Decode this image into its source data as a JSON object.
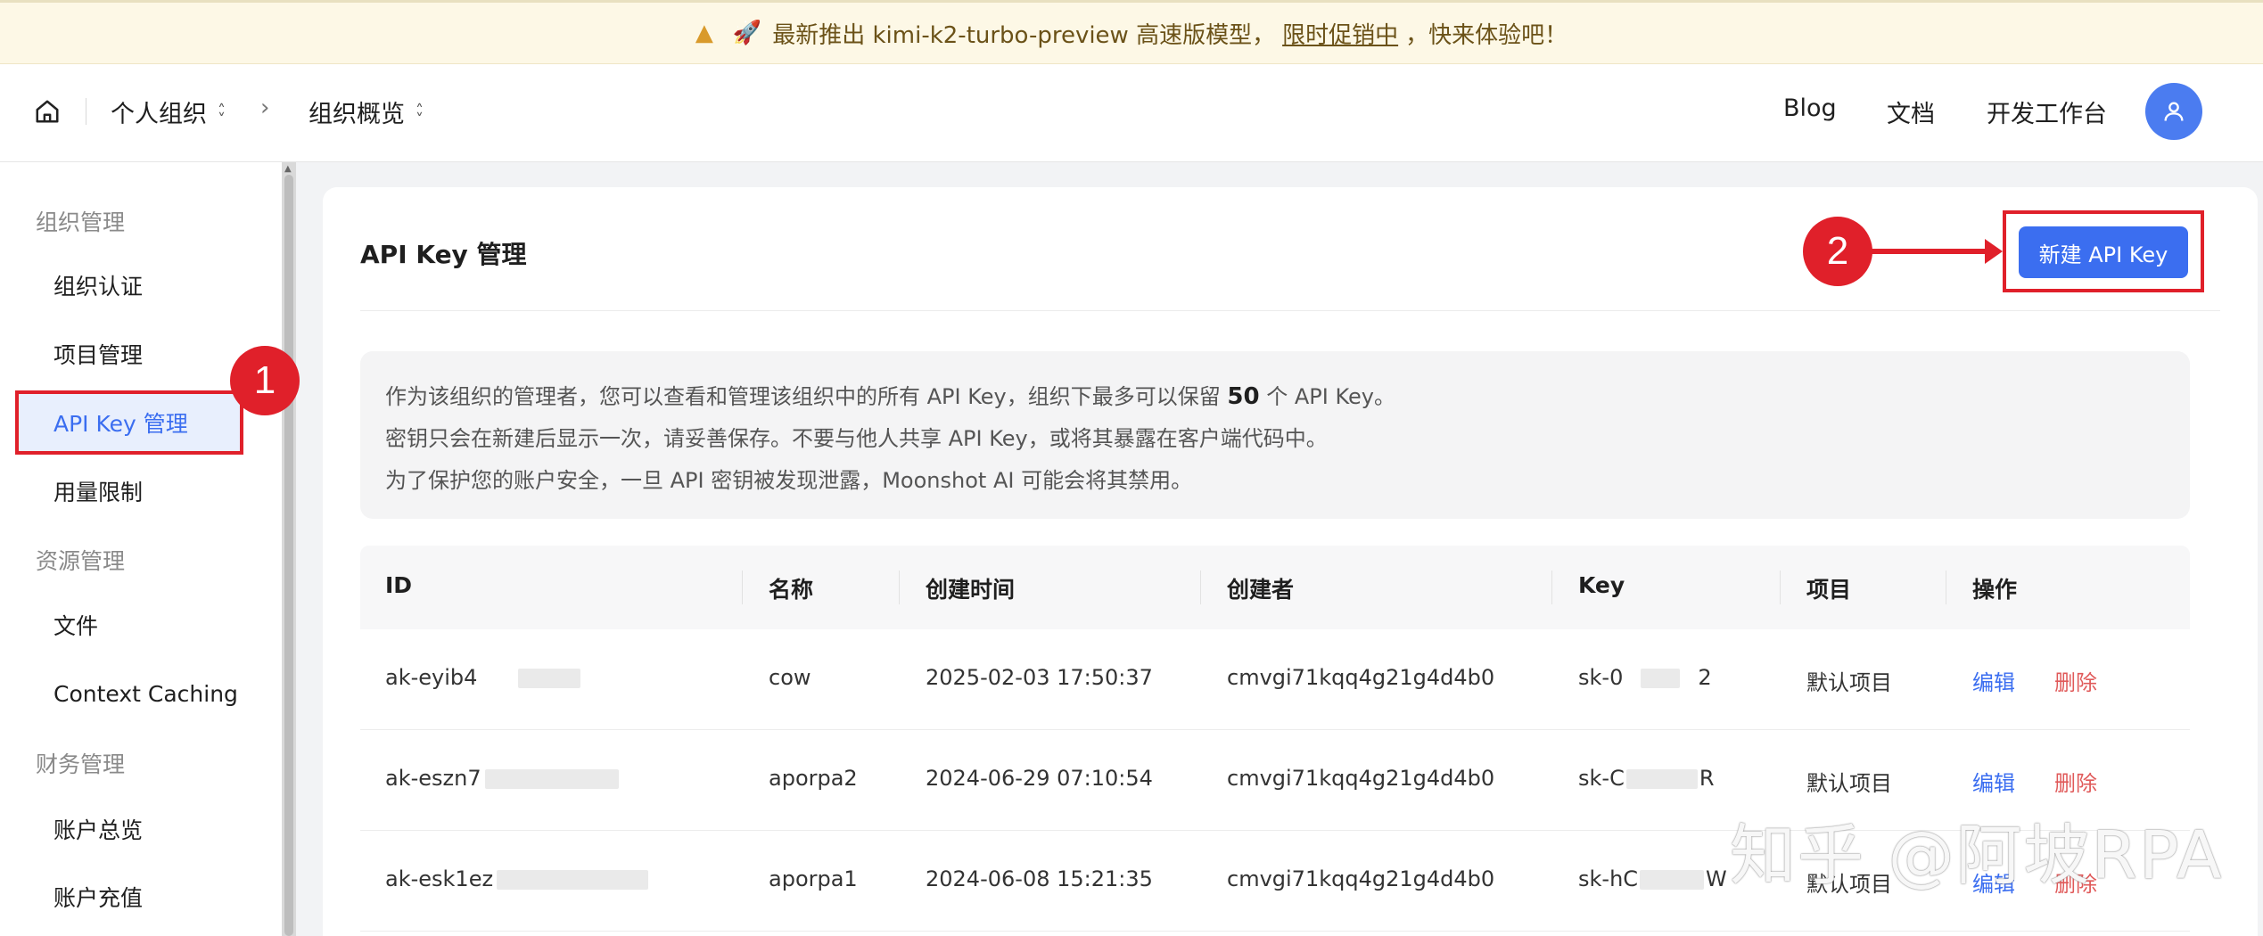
{
  "banner": {
    "text_before": "最新推出 kimi-k2-turbo-preview 高速版模型，",
    "link": "限时促销中",
    "text_after": "，快来体验吧！"
  },
  "topnav": {
    "org": "个人组织",
    "page": "组织概览",
    "links": [
      "Blog",
      "文档",
      "开发工作台"
    ]
  },
  "sidebar": {
    "groups": [
      {
        "title": "组织管理",
        "items": [
          "组织认证",
          "项目管理",
          "API Key 管理",
          "用量限制"
        ]
      },
      {
        "title": "资源管理",
        "items": [
          "文件",
          "Context Caching"
        ]
      },
      {
        "title": "财务管理",
        "items": [
          "账户总览",
          "账户充值"
        ]
      }
    ],
    "active": "API Key 管理"
  },
  "annotations": [
    "1",
    "2"
  ],
  "main": {
    "title": "API Key 管理",
    "new_button": "新建 API Key",
    "info": {
      "line1_before": "作为该组织的管理者，您可以查看和管理该组织中的所有 API Key，组织下最多可以保留",
      "line1_limit": "50",
      "line1_after": "个 API Key。",
      "line2": "密钥只会在新建后显示一次，请妥善保存。不要与他人共享 API Key，或将其暴露在客户端代码中。",
      "line3": "为了保护您的账户安全，一旦 API 密钥被发现泄露，Moonshot AI 可能会将其禁用。"
    },
    "table": {
      "headers": [
        "ID",
        "名称",
        "创建时间",
        "创建者",
        "Key",
        "项目",
        "操作"
      ],
      "rows": [
        {
          "id": "ak-eyib4",
          "name": "cow",
          "created": "2025-02-03 17:50:37",
          "creator": "cmvgi71kqq4g21g4d4b0",
          "key_a": "sk-0",
          "key_b": "2",
          "project": "默认项目",
          "edit": "编辑",
          "delete": "删除"
        },
        {
          "id": "ak-eszn7",
          "name": "aporpa2",
          "created": "2024-06-29 07:10:54",
          "creator": "cmvgi71kqq4g21g4d4b0",
          "key_a": "sk-C",
          "key_b": "R",
          "project": "默认项目",
          "edit": "编辑",
          "delete": "删除"
        },
        {
          "id": "ak-esk1ez",
          "name": "aporpa1",
          "created": "2024-06-08 15:21:35",
          "creator": "cmvgi71kqq4g21g4d4b0",
          "key_a": "sk-hC",
          "key_b": "W",
          "project": "默认项目",
          "edit": "编辑",
          "delete": "删除"
        }
      ]
    }
  },
  "watermark": "知乎 @阿坡RPA"
}
